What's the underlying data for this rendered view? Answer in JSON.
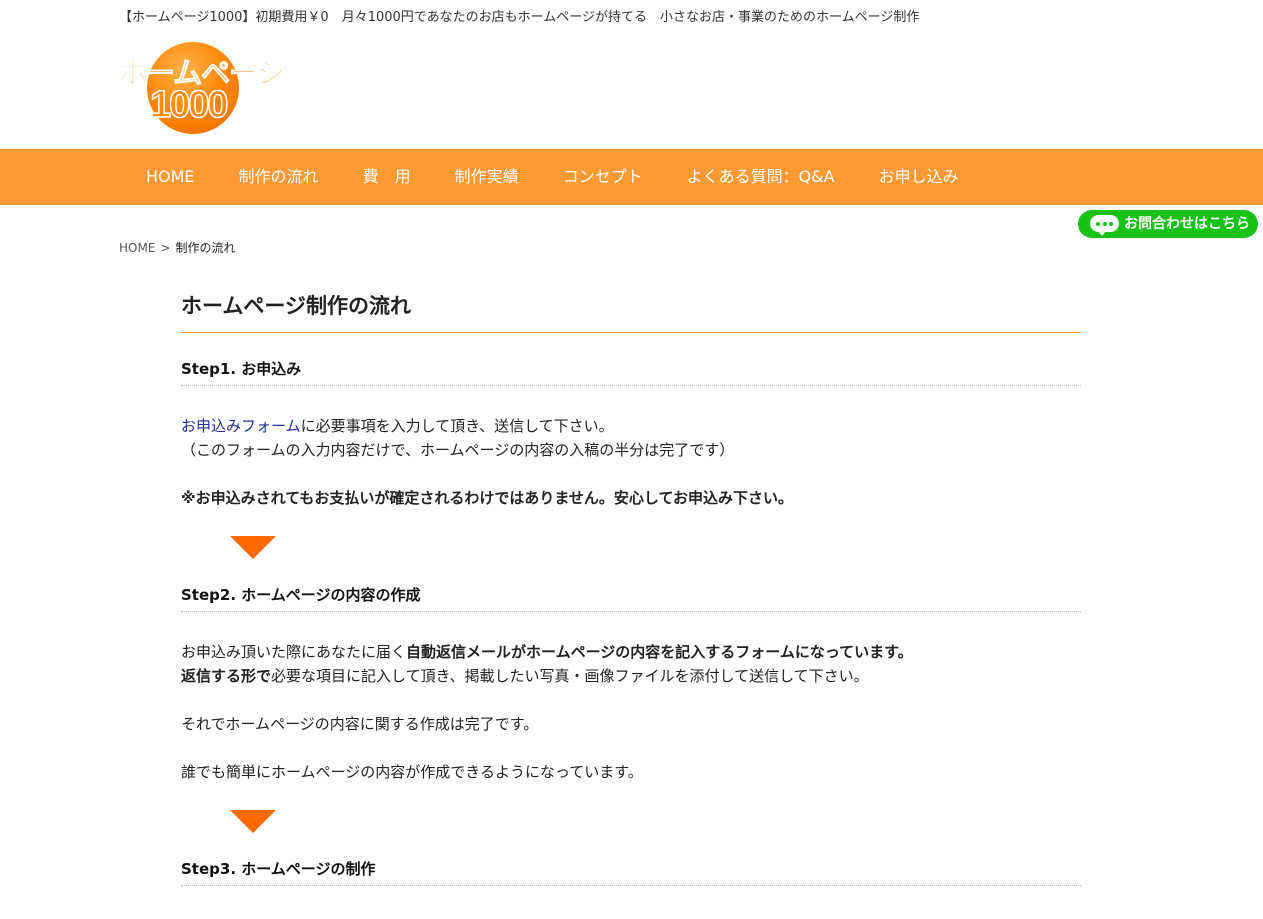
{
  "header": {
    "tagline": "【ホームページ1000】初期費用￥0　月々1000円であなたのお店もホームページが持てる　小さなお店・事業のためのホームページ制作",
    "logo_line1": "ホームページ",
    "logo_line2": "1000"
  },
  "nav": {
    "items": [
      {
        "label": "HOME"
      },
      {
        "label": "制作の流れ"
      },
      {
        "label": "費　用"
      },
      {
        "label": "制作実績"
      },
      {
        "label": "コンセプト"
      },
      {
        "label": "よくある質問：Q&A"
      },
      {
        "label": "お申し込み"
      }
    ]
  },
  "contact_button": {
    "label": "お問合わせはこちら",
    "icon": "chat-bubble-icon",
    "color": "#15c215"
  },
  "breadcrumb": {
    "home": "HOME",
    "separator": ">",
    "current": "制作の流れ"
  },
  "page": {
    "title": "ホームページ制作の流れ",
    "step1": {
      "title": "Step1. お申込み",
      "link_text": "お申込みフォーム",
      "text1_rest": "に必要事項を入力して頂き、送信して下さい。",
      "text2": "（このフォームの入力内容だけで、ホームページの内容の入稿の半分は完了です）",
      "note": "※お申込みされてもお支払いが確定されるわけではありません。安心してお申込み下さい。"
    },
    "step2": {
      "title": "Step2. ホームページの内容の作成",
      "line1_plain": "お申込み頂いた際にあなたに届く",
      "line1_bold": "自動返信メールがホームページの内容を記入するフォームになっています。",
      "line2_bold": "返信する形で",
      "line2_plain": "必要な項目に記入して頂き、掲載したい写真・画像ファイルを添付して送信して下さい。",
      "line3": "それでホームページの内容に関する作成は完了です。",
      "line4": "誰でも簡単にホームページの内容が作成できるようになっています。"
    },
    "step3": {
      "title": "Step3. ホームページの制作"
    }
  },
  "colors": {
    "accent": "#ff9933",
    "arrow": "#ff6a00",
    "link": "#1e2da0"
  }
}
